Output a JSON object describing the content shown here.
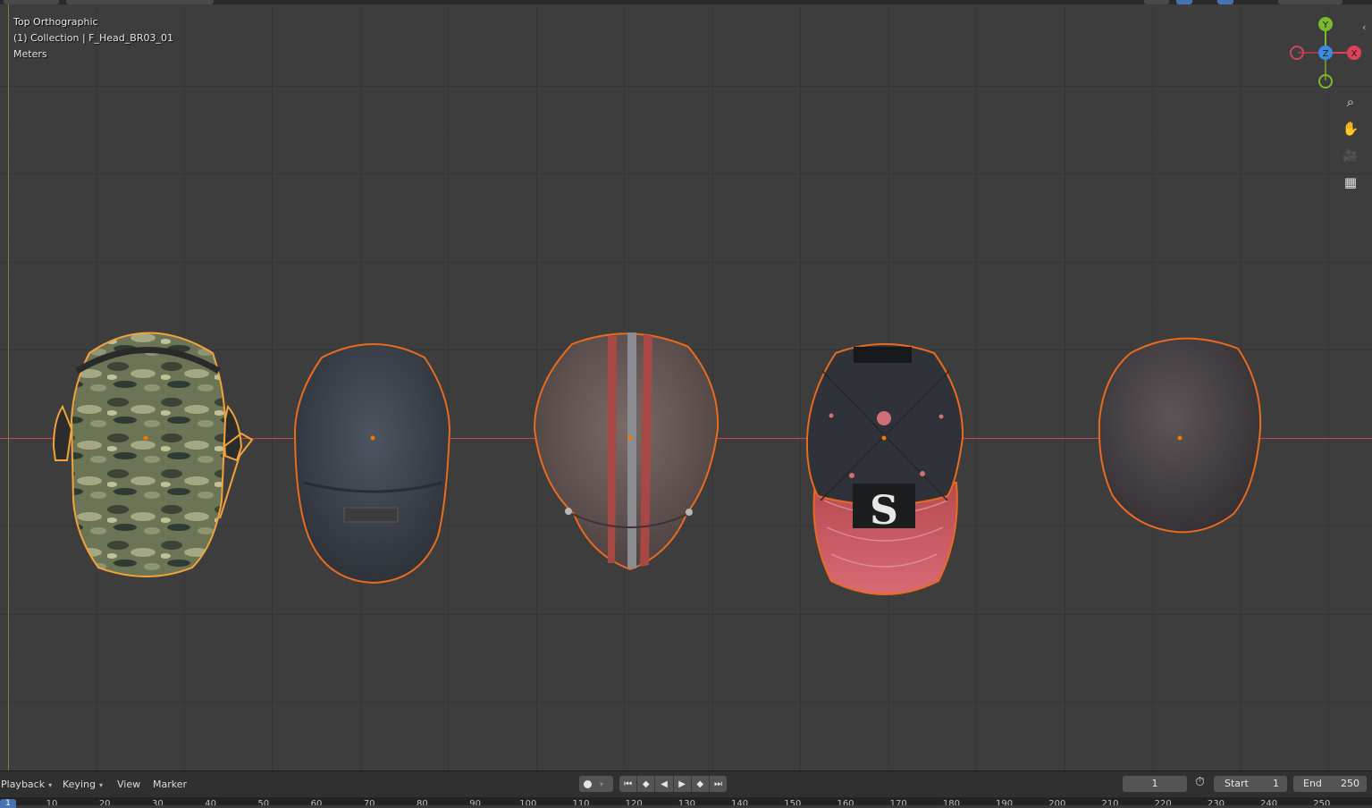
{
  "viewport": {
    "view_name": "Top Orthographic",
    "collection_line": "(1) Collection | F_Head_BR03_01",
    "units": "Meters",
    "objects": [
      {
        "name": "camo-cap",
        "selected_active": true
      },
      {
        "name": "gray-cap",
        "selected_active": false
      },
      {
        "name": "striped-cap",
        "selected_active": false
      },
      {
        "name": "baseball-cap-s",
        "selected_active": false,
        "logo_letter": "S"
      },
      {
        "name": "beanie-cap",
        "selected_active": false
      }
    ]
  },
  "gizmo": {
    "y_label": "Y",
    "z_label": "Z",
    "x_label": "X",
    "colors": {
      "x": "#e0405a",
      "y": "#7bb82e",
      "z": "#3b8ce0"
    }
  },
  "nav_tools": [
    {
      "name": "zoom-icon",
      "glyph": "⌕"
    },
    {
      "name": "pan-hand-icon",
      "glyph": "✋"
    },
    {
      "name": "camera-view-icon",
      "glyph": "🎥"
    },
    {
      "name": "ortho-grid-icon",
      "glyph": "▦"
    }
  ],
  "timeline": {
    "menus": {
      "playback": "Playback",
      "keying": "Keying",
      "view": "View",
      "marker": "Marker"
    },
    "current_frame": "1",
    "start_label": "Start",
    "start_value": "1",
    "end_label": "End",
    "end_value": "250",
    "ruler_current": "1",
    "ruler_ticks": [
      "10",
      "20",
      "30",
      "40",
      "50",
      "60",
      "70",
      "80",
      "90",
      "100",
      "110",
      "120",
      "130",
      "140",
      "150",
      "160",
      "170",
      "180",
      "190",
      "200",
      "210",
      "220",
      "230",
      "240",
      "250"
    ]
  },
  "colors": {
    "selected_active_outline": "#f2a33a",
    "selected_outline": "#ea6a1f",
    "x_axis": "#c8484b",
    "y_axis": "#6a8f2a",
    "accent": "#4772b3"
  }
}
